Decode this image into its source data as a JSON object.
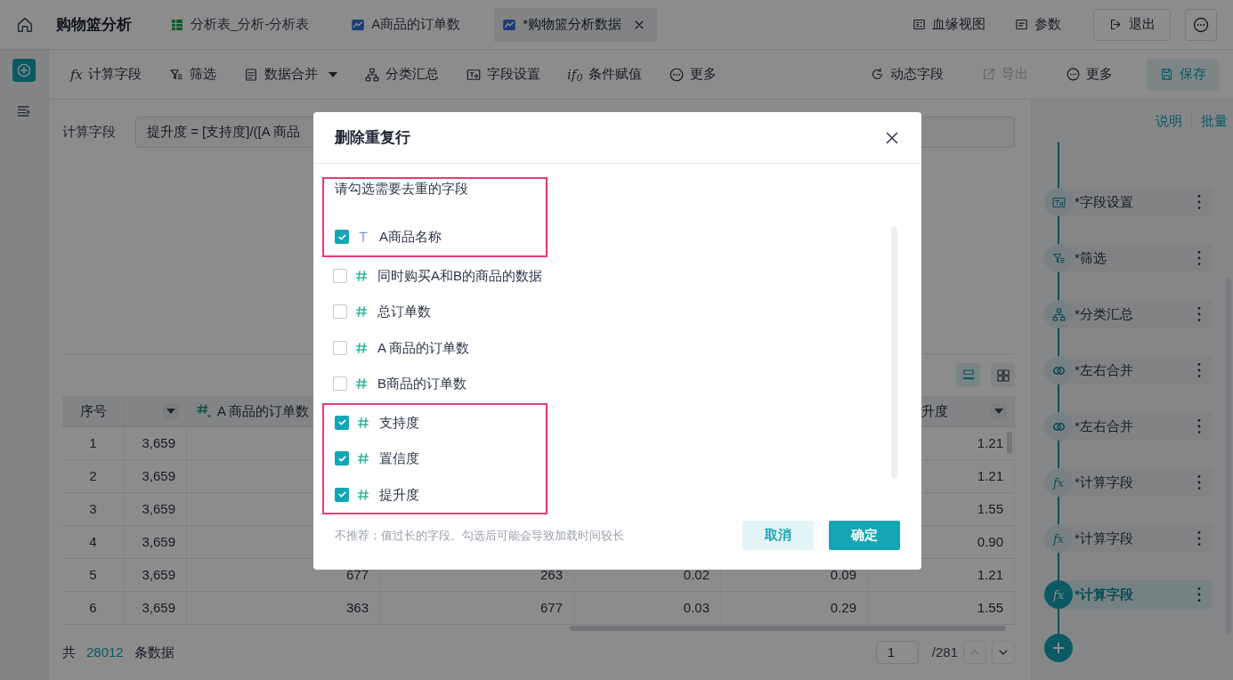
{
  "top_bar": {
    "title": "购物篮分析",
    "tabs": [
      {
        "label": "分析表_分析-分析表",
        "selected": false
      },
      {
        "label": "A商品的订单数",
        "selected": false
      },
      {
        "label": "*购物篮分析数据",
        "selected": true
      }
    ],
    "actions": [
      {
        "label": "血缘视图",
        "kind": "link"
      },
      {
        "label": "参数",
        "kind": "link"
      },
      {
        "label": "退出",
        "kind": "outlined"
      }
    ]
  },
  "toolbar": {
    "left": [
      {
        "label": "计算字段",
        "glyph": "fx",
        "dropdown": false
      },
      {
        "label": "筛选",
        "dropdown": false
      },
      {
        "label": "数据合并",
        "dropdown": true
      },
      {
        "label": "分类汇总",
        "dropdown": false
      },
      {
        "label": "字段设置",
        "dropdown": false
      },
      {
        "label": "条件赋值",
        "glyph": "if$_{0}$",
        "dropdown": false
      },
      {
        "label": "更多",
        "dropdown": false
      }
    ],
    "right": [
      {
        "label": "动态字段",
        "kind": "plain",
        "disabled": false
      },
      {
        "label": "导出",
        "kind": "plain",
        "disabled": true
      },
      {
        "label": "更多",
        "kind": "plain",
        "disabled": false
      },
      {
        "label": "保存",
        "kind": "primary",
        "disabled": false
      }
    ]
  },
  "formula": {
    "label": "计算字段",
    "value": "提升度 = [支持度]/([A 商品"
  },
  "view_toggle": [
    {
      "selected": true
    },
    {
      "selected": false
    }
  ],
  "table": {
    "columns": [
      {
        "label": "序号",
        "filter": false
      },
      {
        "filter": true
      },
      {
        "label": "A 商品的订单数",
        "kind": "number",
        "filter": false
      },
      {},
      {},
      {},
      {
        "label": "升度",
        "filter": true
      }
    ],
    "rows": [
      {
        "cells": [
          "1",
          "3,659",
          null,
          null,
          null,
          null,
          "1.21"
        ]
      },
      {
        "cells": [
          "2",
          "3,659",
          null,
          null,
          null,
          null,
          "1.21"
        ]
      },
      {
        "cells": [
          "3",
          "3,659",
          null,
          null,
          null,
          null,
          "1.55"
        ]
      },
      {
        "cells": [
          "4",
          "3,659",
          null,
          null,
          null,
          null,
          "0.90"
        ]
      },
      {
        "cells": [
          "5",
          "3,659",
          "677",
          "263",
          "0.02",
          "0.09",
          "1.21"
        ]
      },
      {
        "cells": [
          "6",
          "3,659",
          "363",
          "677",
          "0.03",
          "0.29",
          "1.55"
        ]
      }
    ]
  },
  "footer": {
    "prefix": "共",
    "count": "28012",
    "suffix": "条数据"
  },
  "pagination": {
    "page": "1",
    "total": "/281",
    "prev_disabled": true,
    "next_disabled": false
  },
  "sidebar": {
    "links": [
      "说明",
      "批量"
    ],
    "steps": [
      {
        "label": "*字段设置",
        "kind": "fields",
        "selected": false
      },
      {
        "label": "*筛选",
        "kind": "filter",
        "selected": false
      },
      {
        "label": "*分类汇总",
        "kind": "group",
        "selected": false
      },
      {
        "label": "*左右合并",
        "kind": "join",
        "selected": false
      },
      {
        "label": "*左右合并",
        "kind": "join",
        "selected": false
      },
      {
        "label": "*计算字段",
        "kind": "formula",
        "glyph": "fx",
        "selected": false
      },
      {
        "label": "*计算字段",
        "kind": "formula",
        "glyph": "fx",
        "selected": false
      },
      {
        "label": "*计算字段",
        "kind": "formula",
        "glyph": "fx",
        "selected": true
      }
    ]
  },
  "dialog": {
    "title": "删除重复行",
    "items": [
      {
        "kind": "prompt",
        "text": "请勾选需要去重的字段",
        "highlighted": true
      },
      {
        "kind": "text",
        "label": "A商品名称",
        "checked": true,
        "highlighted": true
      },
      {
        "kind": "number",
        "label": "同时购买A和B的商品的数据",
        "checked": false,
        "highlighted": false
      },
      {
        "kind": "number",
        "label": "总订单数",
        "checked": false,
        "highlighted": false
      },
      {
        "kind": "number",
        "label": "A 商品的订单数",
        "checked": false,
        "highlighted": false
      },
      {
        "kind": "number",
        "label": "B商品的订单数",
        "checked": false,
        "highlighted": false
      },
      {
        "kind": "number",
        "label": "支持度",
        "checked": true,
        "highlighted": true
      },
      {
        "kind": "number",
        "label": "置信度",
        "checked": true,
        "highlighted": true
      },
      {
        "kind": "number",
        "label": "提升度",
        "checked": true,
        "highlighted": true
      }
    ],
    "hint": "不推荐：值过长的字段。勾选后可能会导致加载时间较长",
    "buttons": [
      {
        "label": "取消",
        "kind": "secondary"
      },
      {
        "label": "确定",
        "kind": "primary"
      }
    ]
  }
}
